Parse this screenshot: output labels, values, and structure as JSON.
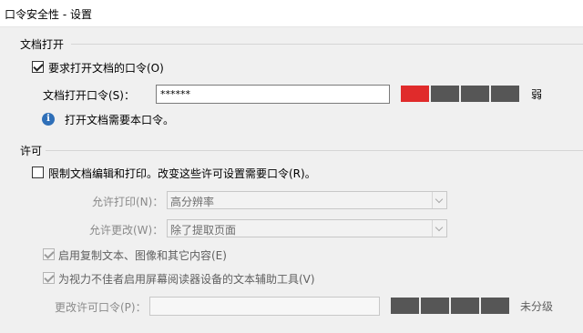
{
  "window": {
    "title": "口令安全性 - 设置"
  },
  "open_section": {
    "title": "文档打开",
    "require_password_label": "要求打开文档的口令(O)",
    "require_password_checked": true,
    "password_label": "文档打开口令(S)：",
    "password_value": "******",
    "strength_text": "弱",
    "strength_level": 0.25,
    "strength_color": "#e02b2b",
    "info_text": "打开文档需要本口令。"
  },
  "permissions_section": {
    "title": "许可",
    "restrict_label": "限制文档编辑和打印。改变这些许可设置需要口令(R)。",
    "restrict_checked": false,
    "print_label": "允许打印(N)：",
    "print_value": "高分辨率",
    "change_label": "允许更改(W)：",
    "change_value": "除了提取页面",
    "copy_label": "启用复制文本、图像和其它内容(E)",
    "copy_checked": true,
    "accessibility_label": "为视力不佳者启用屏幕阅读器设备的文本辅助工具(V)",
    "accessibility_checked": true,
    "change_password_label": "更改许可口令(P)：",
    "change_password_value": "",
    "strength_text": "未分级",
    "strength_level": 0
  }
}
